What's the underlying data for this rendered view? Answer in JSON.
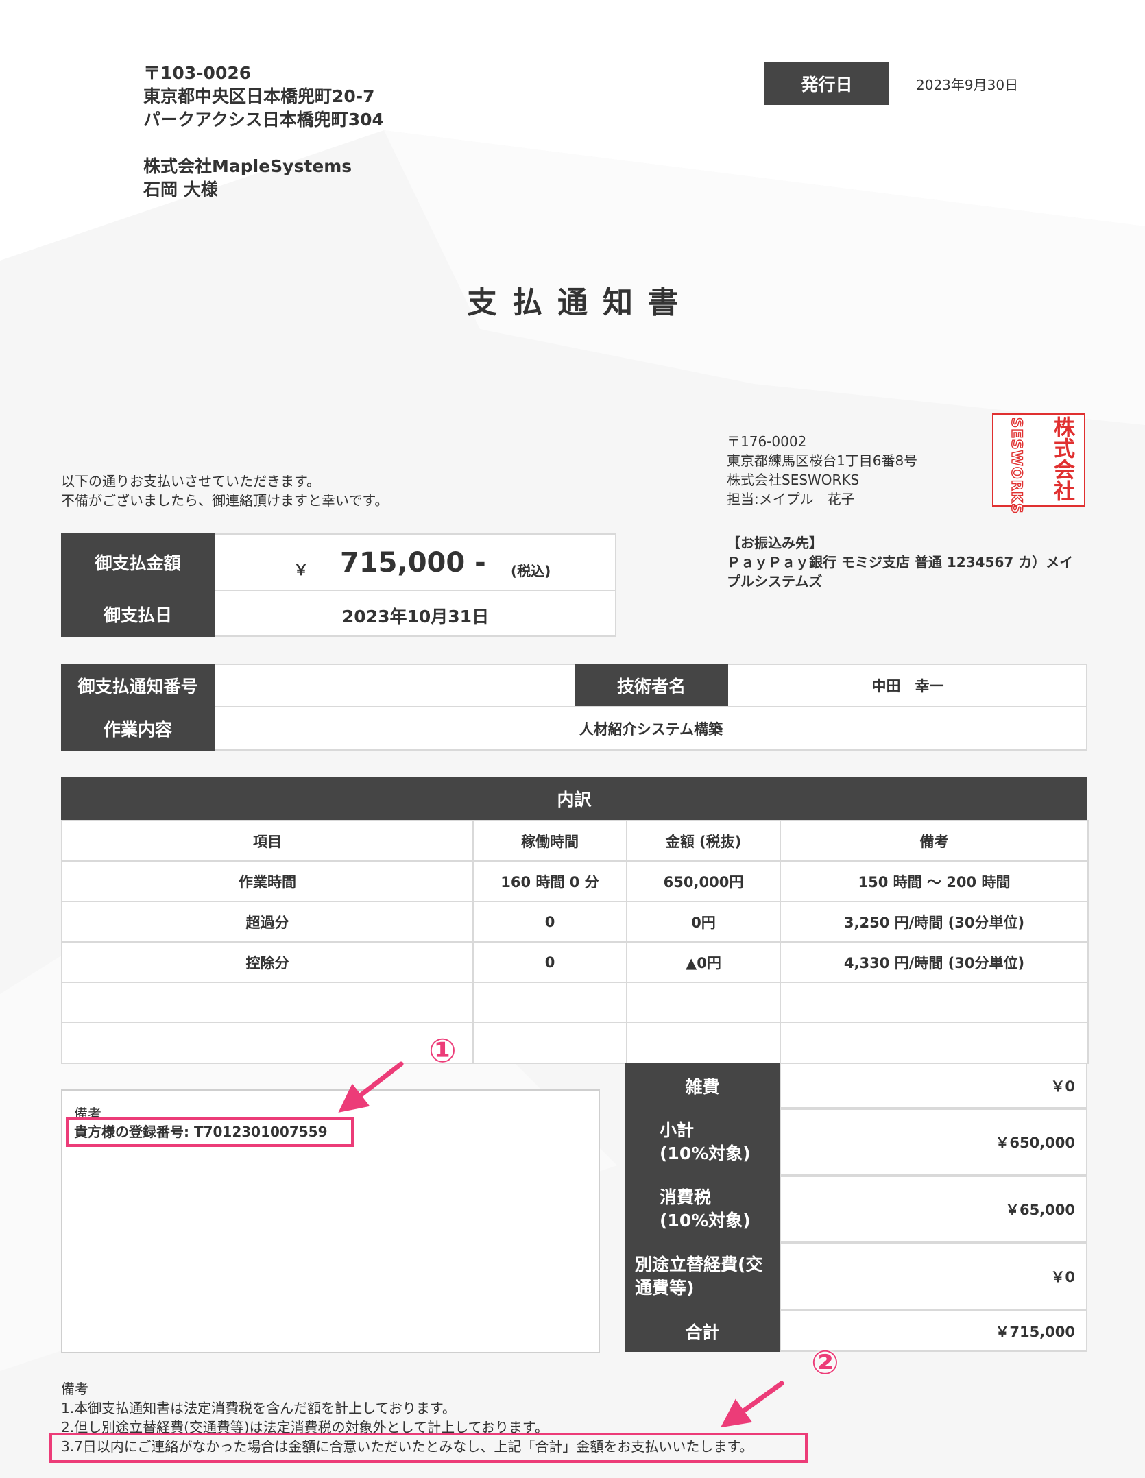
{
  "recipient": {
    "postal": "〒103-0026",
    "address1": "東京都中央区日本橋兜町20-7",
    "address2": "パークアクシス日本橋兜町304",
    "company": "株式会社MapleSystems",
    "person": "石岡 大様"
  },
  "issue": {
    "label": "発行日",
    "date": "2023年9月30日"
  },
  "title": "支払通知書",
  "intro": {
    "line1": "以下の通りお支払いさせていただきます。",
    "line2": "不備がございましたら、御連絡頂けますと幸いです。"
  },
  "sender": {
    "postal": "〒176-0002",
    "address": "東京都練馬区桜台1丁目6番8号",
    "company": "株式会社SESWORKS",
    "contact": "担当:メイプル　花子"
  },
  "seal": {
    "col1": "株式会社",
    "col2": "SESWORKS",
    "color": "#e03030"
  },
  "bank": {
    "label": "【お振込み先】",
    "line1": "ＰａｙＰａｙ銀行 モミジ支店 普通 1234567 カ）メイ",
    "line2": "プルシステムズ"
  },
  "payment": {
    "amount_label": "御支払金額",
    "currency": "￥",
    "amount": "715,000 -",
    "tax_note": "(税込)",
    "date_label": "御支払日",
    "date": "2023年10月31日"
  },
  "info": {
    "notice_no_label": "御支払通知番号",
    "notice_no": "",
    "engineer_label": "技術者名",
    "engineer": "中田　幸一",
    "work_label": "作業内容",
    "work": "人材紹介システム構築"
  },
  "breakdown": {
    "title": "内訳",
    "headers": [
      "項目",
      "稼働時間",
      "金額 (税抜)",
      "備考"
    ],
    "rows": [
      [
        "作業時間",
        "160 時間 0 分",
        "650,000円",
        "150 時間 ～ 200 時間"
      ],
      [
        "超過分",
        "0",
        "0円",
        "3,250 円/時間 (30分単位)"
      ],
      [
        "控除分",
        "0",
        "▲0円",
        "4,330 円/時間 (30分単位)"
      ],
      [
        "",
        "",
        "",
        ""
      ],
      [
        "",
        "",
        "",
        ""
      ]
    ]
  },
  "remarks": {
    "label": "備考",
    "text": "貴方様の登録番号: T7012301007559"
  },
  "summary": [
    {
      "label": "雑費",
      "value": "￥0"
    },
    {
      "label": "小計\n(10%対象)",
      "value": "￥650,000"
    },
    {
      "label": "消費税\n(10%対象)",
      "value": "￥65,000"
    },
    {
      "label": "別途立替経費(交\n通費等)",
      "value": "￥0"
    },
    {
      "label": "合計",
      "value": "￥715,000"
    }
  ],
  "notes": {
    "label": "備考",
    "line1": "1.本御支払通知書は法定消費税を含んだ額を計上しております。",
    "line2": "2.但し別途立替経費(交通費等)は法定消費税の対象外として計上しております。",
    "line3": "3.7日以内にご連絡がなかった場合は金額に合意いただいたとみなし、上記「合計」金額をお支払いいたします。"
  },
  "annotations": {
    "mark1": "①",
    "mark2": "②",
    "color": "#ec3c78"
  }
}
